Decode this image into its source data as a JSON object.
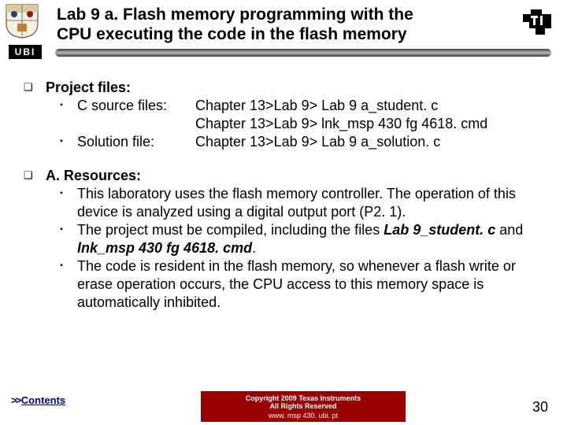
{
  "header": {
    "ubi_label": "UBI",
    "title_line1": "Lab 9 a. Flash memory programming with the",
    "title_line2": "CPU executing the code in the flash memory"
  },
  "bullet_glyphs": {
    "l1": "❑",
    "l2": "▪"
  },
  "section1": {
    "heading": "Project files:",
    "item1_label": "C source files:",
    "item1_v1": "Chapter 13>Lab 9> Lab 9 a_student. c",
    "item1_v2": "Chapter 13>Lab 9> lnk_msp 430 fg 4618. cmd",
    "item2_label": "Solution file:",
    "item2_v1": "Chapter 13>Lab 9> Lab 9 a_solution. c"
  },
  "section2": {
    "heading": "A. Resources:",
    "p1": "This laboratory uses the flash memory controller. The operation of this device is analyzed using a digital output port (P2. 1).",
    "p2a": "The project must be compiled, including the files ",
    "p2_file1": "Lab 9_student. c",
    "p2_and": " and ",
    "p2_file2": "lnk_msp 430 fg 4618. cmd",
    "p2_end": ".",
    "p3": "The code is resident in the flash memory, so whenever a flash write or erase operation occurs, the CPU access to this memory space is automatically inhibited."
  },
  "footer": {
    "contents_arrow": ">> ",
    "contents_text": "Contents",
    "copyright_l1": "Copyright  2009 Texas Instruments",
    "copyright_l2": "All Rights Reserved",
    "copyright_l3": "www. msp 430. ubi. pt",
    "page_number": "30"
  }
}
